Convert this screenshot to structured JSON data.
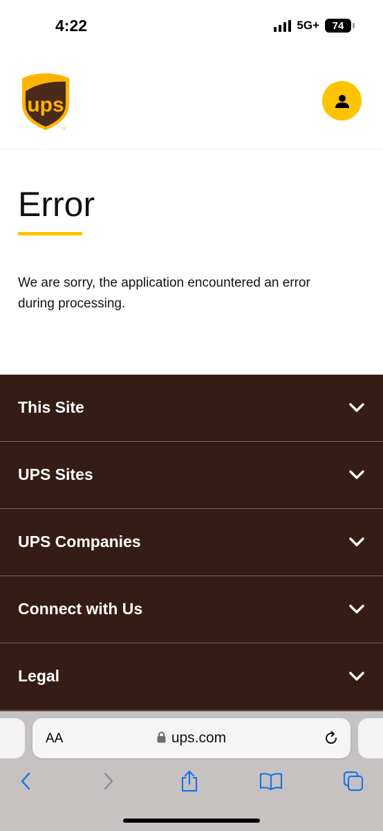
{
  "status_bar": {
    "time": "4:22",
    "network": "5G+",
    "battery": "74"
  },
  "header": {
    "logo_icon": "ups-shield-logo",
    "account_icon": "user-icon",
    "brand_color": "#ffc400",
    "brand_brown": "#351c15"
  },
  "main": {
    "title": "Error",
    "message": "We are sorry, the application encountered an error during processing."
  },
  "footer": {
    "items": [
      {
        "label": "This Site"
      },
      {
        "label": "UPS Sites"
      },
      {
        "label": "UPS Companies"
      },
      {
        "label": "Connect with Us"
      },
      {
        "label": "Legal"
      }
    ]
  },
  "browser": {
    "text_size_label": "AA",
    "url": "ups.com",
    "toolbar_icons": [
      "back-icon",
      "forward-icon",
      "share-icon",
      "bookmarks-icon",
      "tabs-icon"
    ]
  }
}
